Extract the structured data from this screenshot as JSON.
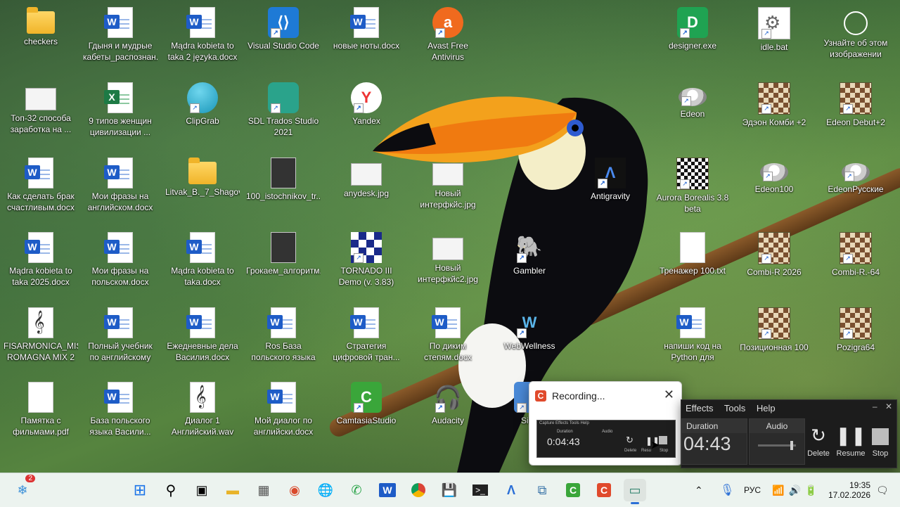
{
  "desktop": {
    "icons": [
      {
        "label": "checkers",
        "type": "folder"
      },
      {
        "label": "Гдыня и мудрые кабеты_распознан...",
        "type": "word"
      },
      {
        "label": "Mądra kobieta to taka 2 języka.docx",
        "type": "word"
      },
      {
        "label": "Visual Studio Code",
        "type": "vscode"
      },
      {
        "label": "новые ноты.docx",
        "type": "word"
      },
      {
        "label": "Avast Free Antivirus",
        "type": "avast"
      },
      {
        "label": "designer.exe",
        "type": "designer"
      },
      {
        "label": "idle.bat",
        "type": "gear"
      },
      {
        "label": "Узнайте об этом изображении",
        "type": "info"
      },
      {
        "label": "Топ-32 способа заработка на ...",
        "type": "pic"
      },
      {
        "label": "9 типов женщин цивилизации ...",
        "type": "excel"
      },
      {
        "label": "ClipGrab",
        "type": "clipgrab"
      },
      {
        "label": "SDL Trados Studio 2021",
        "type": "trados"
      },
      {
        "label": "Yandex",
        "type": "yandex"
      },
      {
        "label": "Edeon",
        "type": "disk"
      },
      {
        "label": "Эдэон Комби +2",
        "type": "chess"
      },
      {
        "label": "Edeon Debut+2",
        "type": "chess"
      },
      {
        "label": "Как сделать брак счастливым.docx",
        "type": "word"
      },
      {
        "label": "Мои фразы на английском.docx",
        "type": "word"
      },
      {
        "label": "Litvak_B._7_Shagov...",
        "type": "folder"
      },
      {
        "label": "100_istochnikov_tr...",
        "type": "book"
      },
      {
        "label": "anydesk.jpg",
        "type": "pic"
      },
      {
        "label": "Новый интерфкйс.jpg",
        "type": "pic"
      },
      {
        "label": "Antigravity",
        "type": "antigravity"
      },
      {
        "label": "Aurora Borealis 3.8 beta",
        "type": "board"
      },
      {
        "label": "Edeon100",
        "type": "disk"
      },
      {
        "label": "EdeonРусские",
        "type": "disk"
      },
      {
        "label": "Mądra kobieta to taka 2025.docx",
        "type": "word"
      },
      {
        "label": "Мои фразы на польском.docx",
        "type": "word"
      },
      {
        "label": "Mądra kobieta to taka.docx",
        "type": "word"
      },
      {
        "label": "Грокаем_алгоритм...",
        "type": "book"
      },
      {
        "label": "TORNADO III Demo (v. 3.83)",
        "type": "tornado"
      },
      {
        "label": "Новый интерфкйс2.jpg",
        "type": "pic"
      },
      {
        "label": "Gambler",
        "type": "gambler"
      },
      {
        "label": "Тренажер 100.txt",
        "type": "doc"
      },
      {
        "label": "Combi-R 2026",
        "type": "chess"
      },
      {
        "label": "Combi-R.-64",
        "type": "chess"
      },
      {
        "label": "FISARMONICA_MISS ROMAGNA MIX 2 (...",
        "type": "music"
      },
      {
        "label": "Полный учебник по английскому Мих...",
        "type": "word"
      },
      {
        "label": "Ежедневные дела Василия.docx",
        "type": "word"
      },
      {
        "label": "Ros База польского языка Василия На...",
        "type": "word"
      },
      {
        "label": "Стратегия цифровой тран...",
        "type": "word"
      },
      {
        "label": "По диким степям.docx",
        "type": "word"
      },
      {
        "label": "WebWellness",
        "type": "webwellness"
      },
      {
        "label": "напиши код на Python для создан...",
        "type": "word"
      },
      {
        "label": "Позиционная 100",
        "type": "chess"
      },
      {
        "label": "Pozigra64",
        "type": "chess"
      },
      {
        "label": "Памятка с фильмами.pdf",
        "type": "doc"
      },
      {
        "label": "База польского языка Васили...",
        "type": "word"
      },
      {
        "label": "Диалог 1 Английский.wav",
        "type": "music"
      },
      {
        "label": "Мой диалог по английски.docx",
        "type": "word"
      },
      {
        "label": "CamtasiaStudio",
        "type": "camtasia"
      },
      {
        "label": "Audacity",
        "type": "audacity"
      },
      {
        "label": "Sibe",
        "type": "sibe"
      }
    ]
  },
  "rec_popup": {
    "title": "Recording...",
    "close": "✕",
    "mini_menu": "Capture   Effects   Tools   Help",
    "mini_duration_label": "Duration",
    "mini_audio_label": "Audio",
    "mini_time": "0:04:43",
    "mini_delete": "Delete",
    "mini_resume": "Resu",
    "mini_stop": "Stop"
  },
  "recorder": {
    "menu": [
      "Effects",
      "Tools",
      "Help"
    ],
    "duration_label": "Duration",
    "time": "04:43",
    "audio_label": "Audio",
    "delete_label": "Delete",
    "resume_label": "Resume",
    "stop_label": "Stop"
  },
  "taskbar": {
    "widgets_badge": "2",
    "lang": "РУС",
    "time": "19:35",
    "date": "17.02.2026"
  },
  "colors": {
    "accent": "#2b6fd6",
    "camtasia_red": "#e04a2c",
    "camtasia_green": "#3aa63a"
  }
}
